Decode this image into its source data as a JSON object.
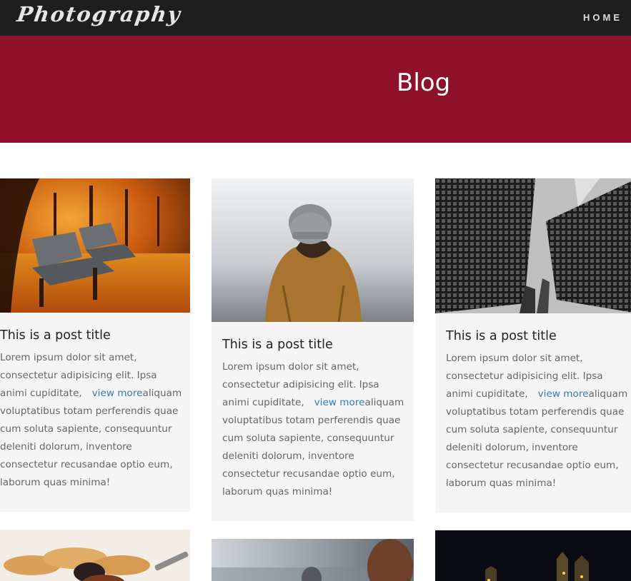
{
  "navbar": {
    "brand": "Photography",
    "links": [
      {
        "label": "HOME"
      }
    ]
  },
  "hero": {
    "title": "Blog"
  },
  "posts": [
    {
      "image": "autumn-park-bench-photo",
      "title": "This is a post title",
      "text_before": "Lorem ipsum dolor sit amet, consectetur adipisicing elit. Ipsa animi cupiditate,",
      "link": "view more",
      "text_after": "aliquam voluptatibus totam perferendis quae cum soluta sapiente, consequuntur deleniti dolorum, inventore consectetur recusandae optio eum, laborum quas minima!"
    },
    {
      "image": "person-in-beanie-photo",
      "title": "This is a post title",
      "text_before": "Lorem ipsum dolor sit amet, consectetur adipisicing elit. Ipsa animi cupiditate,",
      "link": "view more",
      "text_after": "aliquam voluptatibus totam perferendis quae cum soluta sapiente, consequuntur deleniti dolorum, inventore consectetur recusandae optio eum, laborum quas minima!"
    },
    {
      "image": "skyscrapers-photo",
      "title": "This is a post title",
      "text_before": "Lorem ipsum dolor sit amet, consectetur adipisicing elit. Ipsa animi cupiditate,",
      "link": "view more",
      "text_after": "aliquam voluptatibus totam perferendis quae cum soluta sapiente, consequuntur deleniti dolorum, inventore consectetur recusandae optio eum, laborum quas minima!"
    },
    {
      "image": "crackers-food-photo"
    },
    {
      "image": "airplane-cabin-photo"
    },
    {
      "image": "night-city-photo"
    }
  ]
}
